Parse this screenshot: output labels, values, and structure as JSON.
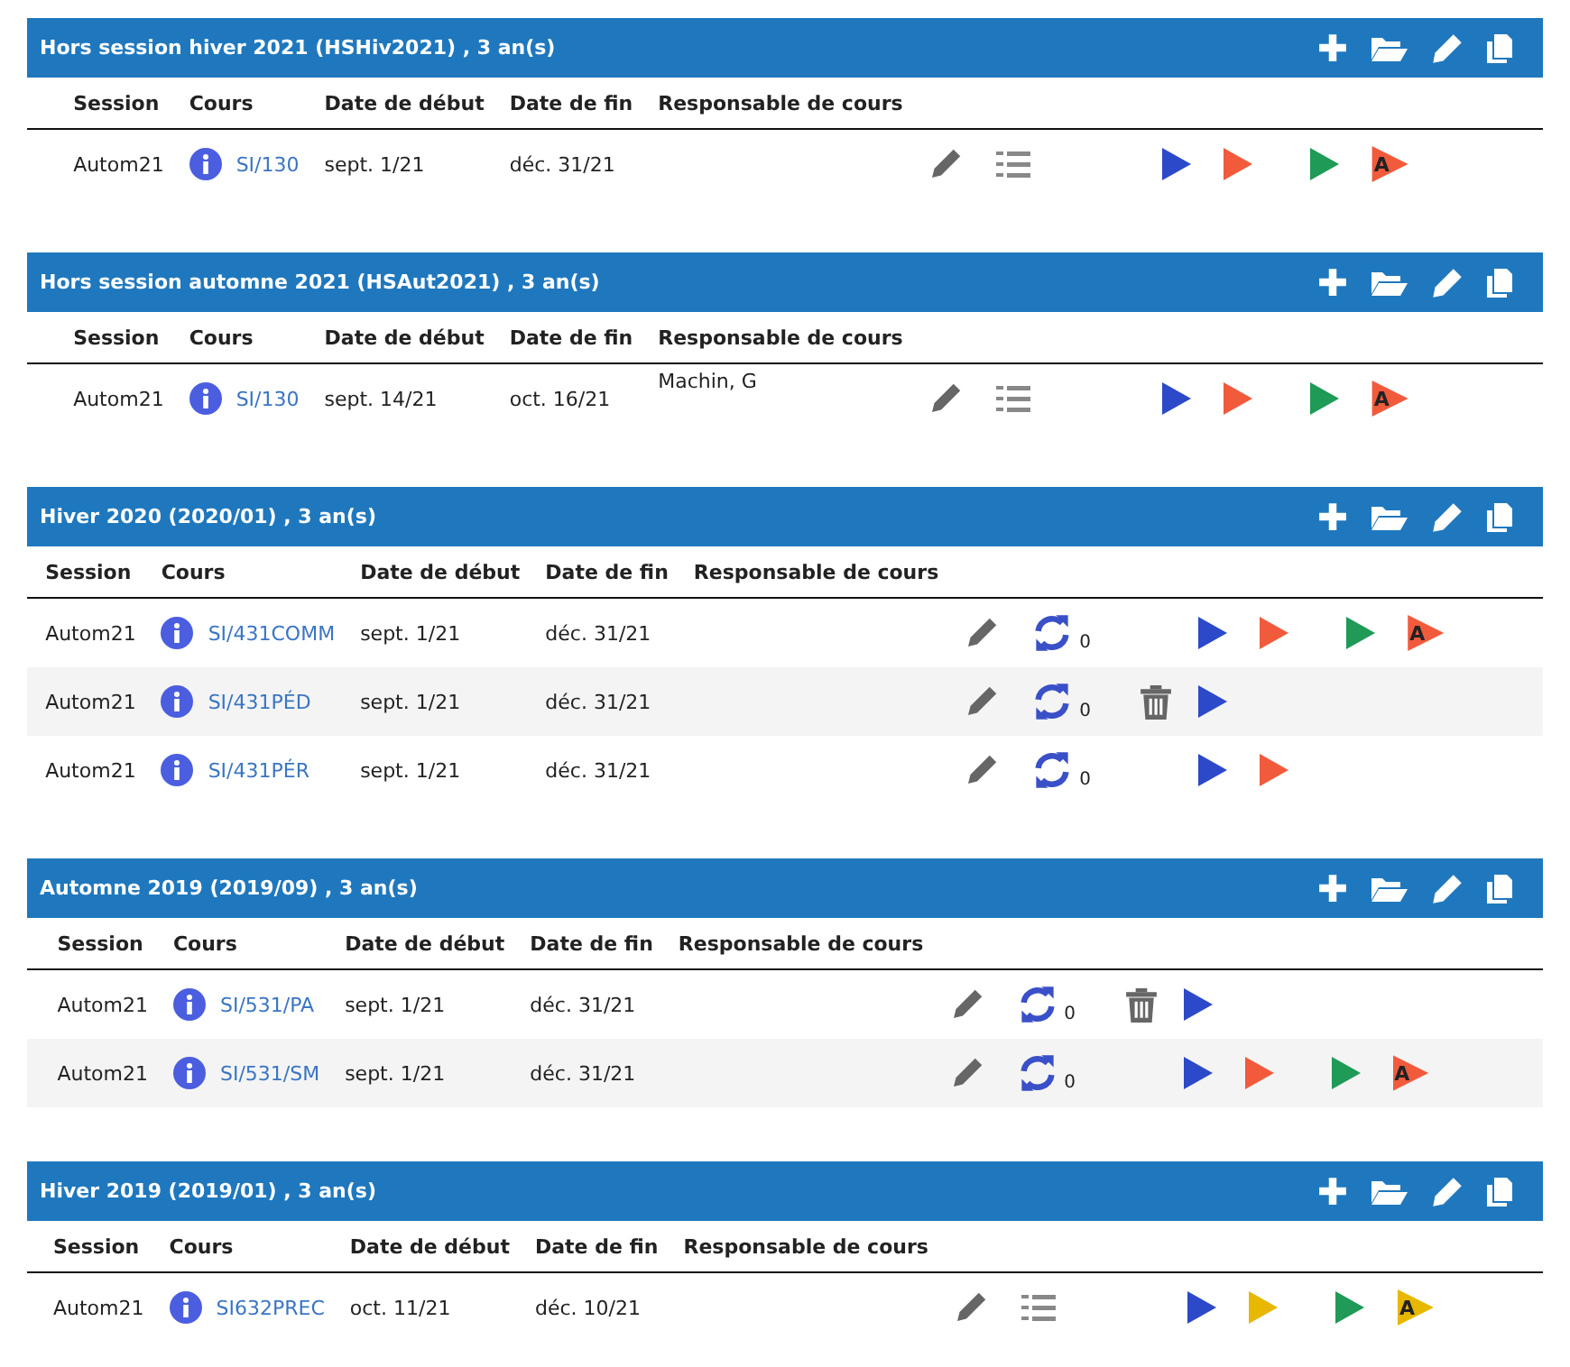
{
  "sections": [
    {
      "title": "Hors session hiver 2021 (HSHiv2021) , 3 an(s)",
      "columns": [
        "Session",
        "Cours",
        "Date de début",
        "Date de fin",
        "Responsable de cours"
      ],
      "rows": [
        {
          "session": "Autom21",
          "course": "SI/130",
          "start": "sept. 1/21",
          "end": "déc. 31/21",
          "responsible": "",
          "secondary": {
            "kind": "list"
          },
          "trash": false,
          "launch": [
            {
              "color": "#2c49c9"
            },
            {
              "color": "#f25a3c"
            }
          ],
          "extra": [
            {
              "color": "#1f9a57"
            },
            {
              "color": "#f25a3c",
              "letter": "A"
            }
          ]
        }
      ]
    },
    {
      "title": "Hors session automne 2021 (HSAut2021) , 3 an(s)",
      "columns": [
        "Session",
        "Cours",
        "Date de début",
        "Date de fin",
        "Responsable de cours"
      ],
      "rows": [
        {
          "session": "Autom21",
          "course": "SI/130",
          "start": "sept. 14/21",
          "end": "oct. 16/21",
          "responsible": "Machin, G",
          "secondary": {
            "kind": "list"
          },
          "trash": false,
          "launch": [
            {
              "color": "#2c49c9"
            },
            {
              "color": "#f25a3c"
            }
          ],
          "extra": [
            {
              "color": "#1f9a57"
            },
            {
              "color": "#f25a3c",
              "letter": "A"
            }
          ]
        }
      ]
    },
    {
      "title": "Hiver 2020 (2020/01) , 3 an(s)",
      "columns": [
        "Session",
        "Cours",
        "Date de début",
        "Date de fin",
        "Responsable de cours"
      ],
      "rows": [
        {
          "session": "Autom21",
          "course": "SI/431COMM",
          "start": "sept. 1/21",
          "end": "déc. 31/21",
          "responsible": "",
          "secondary": {
            "kind": "sync",
            "count": "0"
          },
          "trash": false,
          "launch": [
            {
              "color": "#2c49c9"
            },
            {
              "color": "#f25a3c"
            }
          ],
          "extra": [
            {
              "color": "#1f9a57"
            },
            {
              "color": "#f25a3c",
              "letter": "A"
            }
          ]
        },
        {
          "session": "Autom21",
          "course": "SI/431PÉD",
          "start": "sept. 1/21",
          "end": "déc. 31/21",
          "responsible": "",
          "secondary": {
            "kind": "sync",
            "count": "0"
          },
          "trash": true,
          "launch": [
            {
              "color": "#2c49c9"
            }
          ],
          "extra": []
        },
        {
          "session": "Autom21",
          "course": "SI/431PÉR",
          "start": "sept. 1/21",
          "end": "déc. 31/21",
          "responsible": "",
          "secondary": {
            "kind": "sync",
            "count": "0"
          },
          "trash": false,
          "launch": [
            {
              "color": "#2c49c9"
            },
            {
              "color": "#f25a3c"
            }
          ],
          "extra": []
        }
      ]
    },
    {
      "title": "Automne 2019 (2019/09) , 3 an(s)",
      "columns": [
        "Session",
        "Cours",
        "Date de début",
        "Date de fin",
        "Responsable de cours"
      ],
      "rows": [
        {
          "session": "Autom21",
          "course": "SI/531/PA",
          "start": "sept. 1/21",
          "end": "déc. 31/21",
          "responsible": "",
          "secondary": {
            "kind": "sync",
            "count": "0"
          },
          "trash": true,
          "launch": [
            {
              "color": "#2c49c9"
            }
          ],
          "extra": []
        },
        {
          "session": "Autom21",
          "course": "SI/531/SM",
          "start": "sept. 1/21",
          "end": "déc. 31/21",
          "responsible": "",
          "secondary": {
            "kind": "sync",
            "count": "0"
          },
          "trash": false,
          "launch": [
            {
              "color": "#2c49c9"
            },
            {
              "color": "#f25a3c"
            }
          ],
          "extra": [
            {
              "color": "#1f9a57"
            },
            {
              "color": "#f25a3c",
              "letter": "A"
            }
          ]
        }
      ]
    },
    {
      "title": "Hiver 2019 (2019/01) , 3 an(s)",
      "columns": [
        "Session",
        "Cours",
        "Date de début",
        "Date de fin",
        "Responsable de cours"
      ],
      "rows": [
        {
          "session": "Autom21",
          "course": "SI632PREC",
          "start": "oct. 11/21",
          "end": "déc. 10/21",
          "responsible": "",
          "secondary": {
            "kind": "list"
          },
          "trash": false,
          "launch": [
            {
              "color": "#2c49c9"
            },
            {
              "color": "#e8b800"
            }
          ],
          "extra": [
            {
              "color": "#1f9a57"
            },
            {
              "color": "#e8b800",
              "letter": "A"
            }
          ]
        }
      ]
    }
  ]
}
